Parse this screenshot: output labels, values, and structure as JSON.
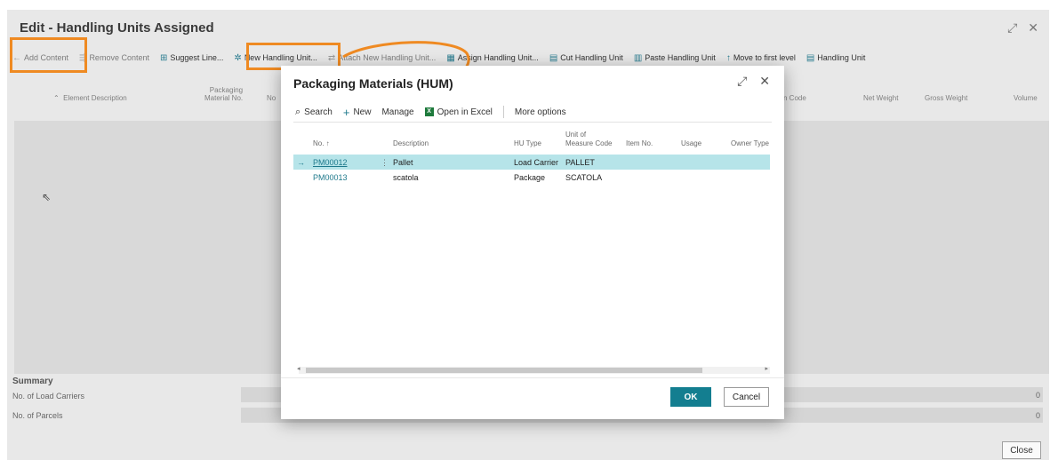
{
  "window": {
    "title": "Edit - Handling Units Assigned",
    "expand_icon": "⤢",
    "close_icon": "✕"
  },
  "toolbar": [
    {
      "icon": "←",
      "label": "Add Content"
    },
    {
      "icon": "⇶",
      "label": "Remove Content"
    },
    {
      "icon": "⊞",
      "label": "Suggest Line..."
    },
    {
      "icon": "✲",
      "label": "New Handling Unit..."
    },
    {
      "icon": "⇄",
      "label": "Attach New Handling Unit..."
    },
    {
      "icon": "▦",
      "label": "Assign Handling Unit..."
    },
    {
      "icon": "▤",
      "label": "Cut Handling Unit"
    },
    {
      "icon": "▥",
      "label": "Paste Handling Unit"
    },
    {
      "icon": "↑",
      "label": "Move to first level"
    },
    {
      "icon": "▤",
      "label": "Handling Unit"
    }
  ],
  "columns": {
    "sort_icon": "⌃",
    "element_description": "Element Description",
    "packaging_material_no_1": "Packaging",
    "packaging_material_no_2": "Material No.",
    "no_fragment": "No",
    "code_fragment": "n Code",
    "net_weight": "Net Weight",
    "gross_weight": "Gross Weight",
    "volume": "Volume"
  },
  "summary": {
    "title": "Summary",
    "load_carriers_label": "No. of Load Carriers",
    "load_carriers_value": "0",
    "parcels_label": "No. of Parcels",
    "parcels_value": "0"
  },
  "close_label": "Close",
  "dialog": {
    "title": "Packaging Materials (HUM)",
    "expand_icon": "⤢",
    "close_icon": "✕",
    "actions": {
      "search": "Search",
      "new": "New",
      "manage": "Manage",
      "excel": "Open in Excel",
      "more": "More options"
    },
    "headers": {
      "no": "No. ↑",
      "description": "Description",
      "hu_type": "HU Type",
      "uom_1": "Unit of",
      "uom_2": "Measure Code",
      "item_no": "Item No.",
      "usage": "Usage",
      "owner_type": "Owner Type"
    },
    "rows": [
      {
        "no": "PM00012",
        "description": "Pallet",
        "hu_type": "Load Carrier",
        "uom": "PALLET"
      },
      {
        "no": "PM00013",
        "description": "scatola",
        "hu_type": "Package",
        "uom": "SCATOLA"
      }
    ],
    "ok": "OK",
    "cancel": "Cancel"
  },
  "colors": {
    "accent": "#137e90",
    "highlight": "#ef8a22",
    "selected_row": "#b6e4e9"
  }
}
